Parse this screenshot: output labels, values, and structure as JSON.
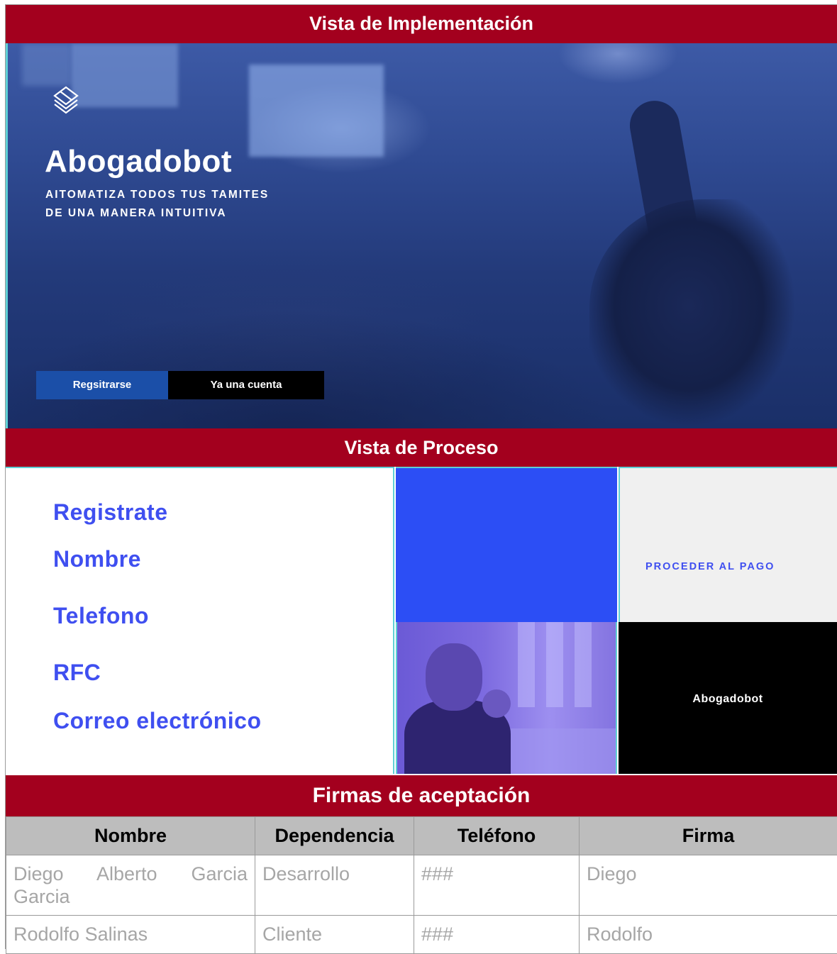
{
  "sections": {
    "implementation_title": "Vista de Implementación",
    "process_title": "Vista de Proceso",
    "signatures_title": "Firmas de aceptación"
  },
  "hero": {
    "logo_icon": "layered-diamond-icon",
    "title": "Abogadobot",
    "subtitle": "AITOMATIZA TODOS TUS TAMITES\nDE UNA MANERA INTUITIVA",
    "register_button": "Regsitrarse",
    "account_button": "Ya una cuenta",
    "colors": {
      "overlay": "#2f4a92",
      "register": "#1b4fa8",
      "account": "#000000"
    }
  },
  "process": {
    "form_title": "Registrate",
    "fields": [
      "Nombre",
      "Telefono",
      "RFC",
      "Correo electrónico"
    ],
    "pay_label": "PROCEDER AL PAGO",
    "brand_label": "Abogadobot",
    "colors": {
      "label": "#3f4ff0",
      "tile_blue": "#2c4ef5",
      "tile_gray": "#f0f0f0"
    }
  },
  "signatures": {
    "headers": [
      "Nombre",
      "Dependencia",
      "Teléfono",
      "Firma"
    ],
    "rows": [
      [
        "Diego Alberto Garcia Garcia",
        "Desarrollo",
        "###",
        "Diego"
      ],
      [
        "Rodolfo Salinas",
        "Cliente",
        "###",
        "Rodolfo"
      ]
    ]
  },
  "colors": {
    "header_bar": "#a3001e",
    "table_header": "#bdbdbd",
    "cell_text": "#a6a6a6"
  }
}
